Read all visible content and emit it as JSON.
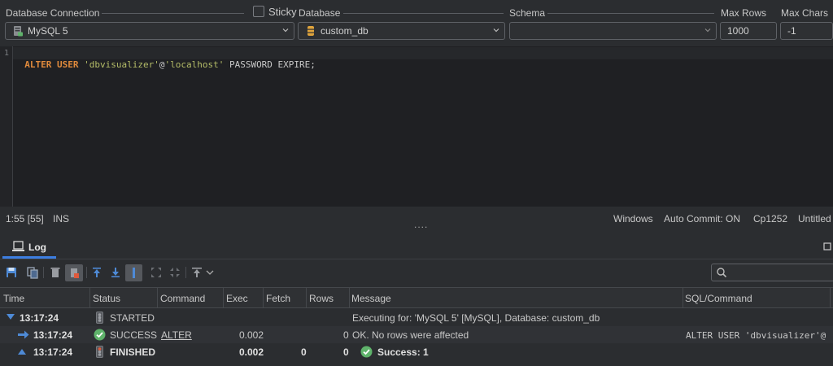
{
  "toolbar": {
    "db_connection_label": "Database Connection",
    "sticky_label": "Sticky",
    "database_label": "Database",
    "schema_label": "Schema",
    "max_rows_label": "Max Rows",
    "max_chars_label": "Max Chars",
    "connection_value": "MySQL 5",
    "database_value": "custom_db",
    "schema_value": "",
    "max_rows_value": "1000",
    "max_chars_value": "-1"
  },
  "editor": {
    "line_number": "1",
    "code": {
      "kw1": "ALTER",
      "kw2": "USER",
      "str1": "'dbvisualizer'",
      "at": "@",
      "str2": "'localhost'",
      "rest": " PASSWORD EXPIRE;"
    }
  },
  "statusbar": {
    "position": "1:55 [55]",
    "mode": "INS",
    "line_endings": "Windows",
    "auto_commit": "Auto Commit: ON",
    "encoding": "Cp1252",
    "doc": "Untitled",
    "splitter": "...."
  },
  "log_tab": {
    "label": "Log"
  },
  "log_table": {
    "headers": [
      "Time",
      "Status",
      "Command",
      "Exec",
      "Fetch",
      "Rows",
      "Message",
      "SQL/Command"
    ],
    "rows": [
      {
        "time": "13:17:24",
        "status": "STARTED",
        "command": "",
        "exec": "",
        "fetch": "",
        "rows": "",
        "message": "Executing for: 'MySQL 5' [MySQL], Database: custom_db",
        "sql": ""
      },
      {
        "time": "13:17:24",
        "status": "SUCCESS",
        "command": "ALTER",
        "exec": "0.002",
        "fetch": "",
        "rows": "0",
        "message": "OK. No rows were affected",
        "sql": "ALTER USER 'dbvisualizer'@"
      },
      {
        "time": "13:17:24",
        "status": "FINISHED",
        "command": "",
        "exec": "0.002",
        "fetch": "0",
        "rows": "0",
        "message": "Success: 1",
        "sql": ""
      }
    ]
  },
  "colors": {
    "keyword": "#e08a3c",
    "string": "#b5bd68",
    "success": "#5fb36b",
    "accent": "#3d7ee0"
  }
}
